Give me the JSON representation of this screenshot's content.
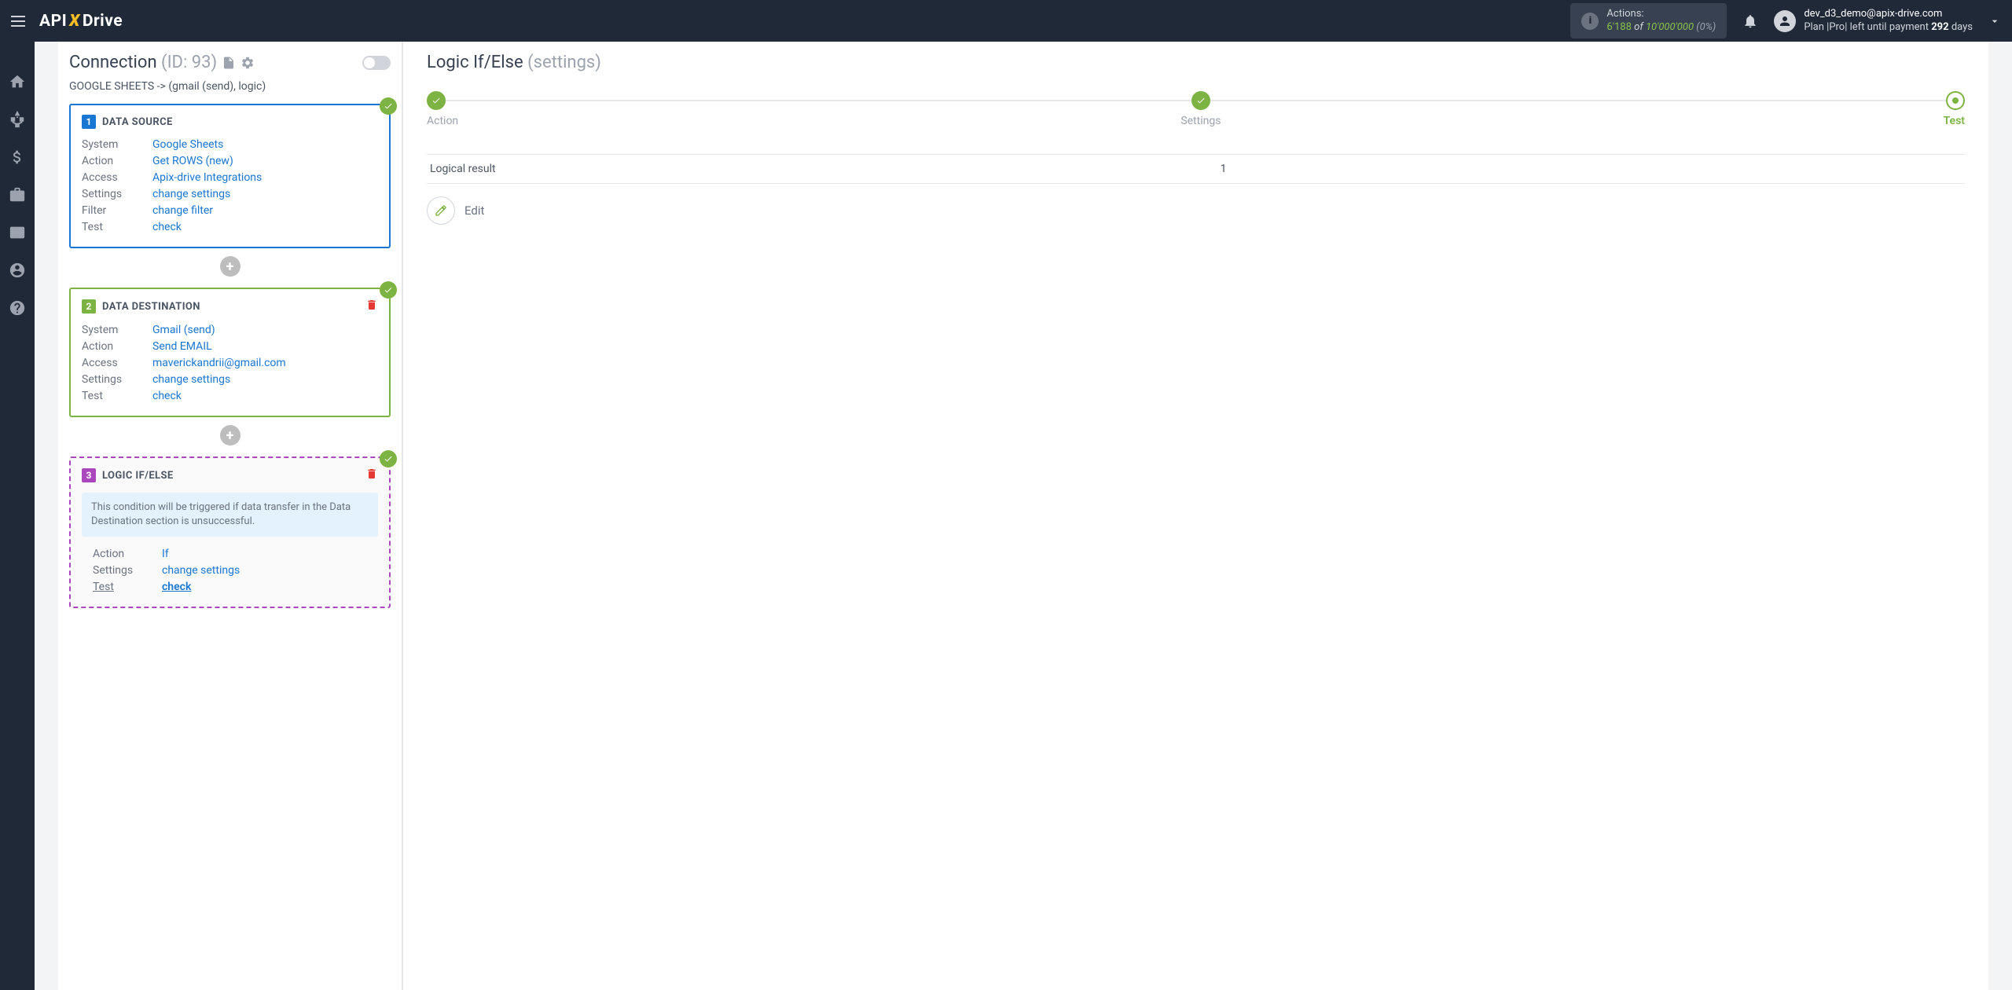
{
  "brand": {
    "pre": "API",
    "x": "X",
    "post": "Drive"
  },
  "topbar": {
    "actions_label": "Actions:",
    "actions_used": "6'188",
    "actions_of": "of",
    "actions_max": "10'000'000",
    "actions_pct": "(0%)"
  },
  "user": {
    "email": "dev_d3_demo@apix-drive.com",
    "plan_pre": "Plan |Pro| left until payment ",
    "plan_days": "292",
    "plan_post": " days"
  },
  "conn": {
    "title": "Connection ",
    "id_label": "(ID: 93)",
    "subtitle": "GOOGLE SHEETS -> (gmail (send), logic)"
  },
  "labels": {
    "system": "System",
    "action": "Action",
    "access": "Access",
    "settings": "Settings",
    "filter": "Filter",
    "test": "Test"
  },
  "links": {
    "change_settings": "change settings",
    "change_filter": "change filter",
    "check": "check"
  },
  "card1": {
    "num": "1",
    "title": "DATA SOURCE",
    "system": "Google Sheets",
    "action": "Get ROWS (new)",
    "access": "Apix-drive Integrations"
  },
  "card2": {
    "num": "2",
    "title": "DATA DESTINATION",
    "system": "Gmail (send)",
    "action": "Send EMAIL",
    "access": "maverickandrii@gmail.com"
  },
  "card3": {
    "num": "3",
    "title": "LOGIC IF/ELSE",
    "info": "This condition will be triggered if data transfer in the Data Destination section is unsuccessful.",
    "action": "If"
  },
  "right": {
    "title": "Logic If/Else ",
    "title_sub": "(settings)",
    "step1": "Action",
    "step2": "Settings",
    "step3": "Test",
    "result_label": "Logical result",
    "result_value": "1",
    "edit": "Edit"
  }
}
